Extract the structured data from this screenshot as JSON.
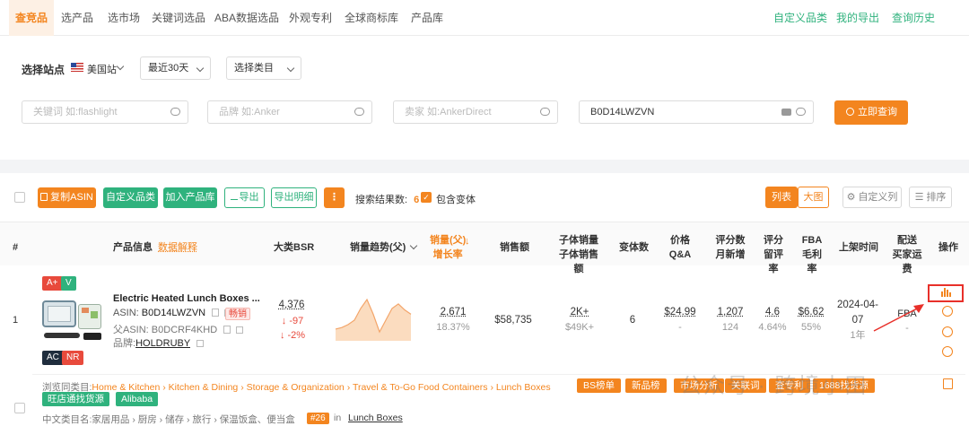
{
  "top_tabs": [
    "查竞品",
    "选产品",
    "选市场",
    "关键词选品",
    "ABA数据选品",
    "外观专利",
    "全球商标库",
    "产品库"
  ],
  "top_links": [
    "自定义品类",
    "我的导出",
    "查询历史"
  ],
  "filter": {
    "site_label": "选择站点",
    "site_value": "美国站",
    "period_value": "最近30天",
    "category_value": "选择类目",
    "keyword_placeholder": "关键词 如:flashlight",
    "brand_placeholder": "品牌 如:Anker",
    "seller_placeholder": "卖家 如:AnkerDirect",
    "asin_value": "B0D14LWZVN",
    "search_button": "立即查询"
  },
  "toolbar": {
    "copy_asin": "复制ASIN",
    "custom_category": "自定义品类",
    "add_library": "加入产品库",
    "export": "导出",
    "export_detail": "导出明细",
    "more": "⋮",
    "results_label": "搜索结果数:",
    "results_count": "6",
    "include_variants": "包含变体",
    "view_list": "列表",
    "view_grid": "大图",
    "custom_columns": "自定义列",
    "sort": "排序"
  },
  "columns": {
    "index": "#",
    "product_info": "产品信息",
    "data_explain": "数据解释",
    "bsr": "大类BSR",
    "trend": "销量趋势(父)",
    "sales_1": "销量(父)",
    "sales_2": "增长率",
    "revenue": "销售额",
    "child_1": "子体销量",
    "child_2": "子体销售额",
    "variants": "变体数",
    "price_1": "价格",
    "price_2": "Q&A",
    "reviews_1": "评分数",
    "reviews_2": "月新增",
    "rating_1": "评分",
    "rating_2": "留评率",
    "fba_1": "FBA",
    "fba_2": "毛利率",
    "launch": "上架时间",
    "ship_1": "配送",
    "ship_2": "买家运费",
    "action": "操作"
  },
  "row": {
    "index": "1",
    "badge_aplus": "A+",
    "badge_v": "V",
    "badge_ac": "AC",
    "badge_nr": "NR",
    "title": "Electric Heated Lunch Boxes ...",
    "asin_label": "ASIN:",
    "asin": "B0D14LWZVN",
    "hot_tag": "畅销",
    "parent_label": "父ASIN:",
    "parent_asin": "B0DCRF4KHD",
    "brand_label": "品牌:",
    "brand": "HOLDRUBY",
    "bsr": "4,376",
    "bsr_change": "↓ -97",
    "bsr_pct": "↓ -2%",
    "sales": "2,671",
    "growth": "18.37%",
    "revenue": "$58,735",
    "child_sales": "2K+",
    "child_revenue": "$49K+",
    "variants": "6",
    "price": "$24.99",
    "qa": "-",
    "ratings": "1,207",
    "ratings_new": "124",
    "rating": "4.6",
    "review_rate": "4.64%",
    "fba": "$6.62",
    "margin": "55%",
    "launch_date_1": "2024-04-",
    "launch_date_2": "07",
    "launch_age": "1年",
    "shipping": "FBA",
    "shipping_fee": "-"
  },
  "trend_points": [
    8,
    9,
    11,
    14,
    22,
    28,
    18,
    6,
    14,
    22,
    25,
    21,
    18
  ],
  "breadcrumb": {
    "label": "浏览同类目:",
    "items": [
      "Home & Kitchen",
      "Kitchen & Dining",
      "Storage & Organization",
      "Travel & To-Go Food Containers",
      "Lunch Boxes"
    ],
    "sep": "›"
  },
  "row_tags": [
    "BS榜单",
    "新品榜",
    "市场分析",
    "关联词",
    "查专利",
    "1688找货源"
  ],
  "row_tags_green": [
    "旺店通找货源",
    "Alibaba"
  ],
  "cn_category": {
    "label": "中文类目名:",
    "value": "家居用品 › 厨房 › 储存 › 旅行 › 保温饭盒、便当盒",
    "rank": "#26",
    "in": "in",
    "category": "Lunch Boxes"
  },
  "watermark": "公众号 · 跨境小田",
  "colors": {
    "brand_orange": "#f3851f",
    "brand_green": "#2fb27d",
    "red": "#e84a3c"
  }
}
